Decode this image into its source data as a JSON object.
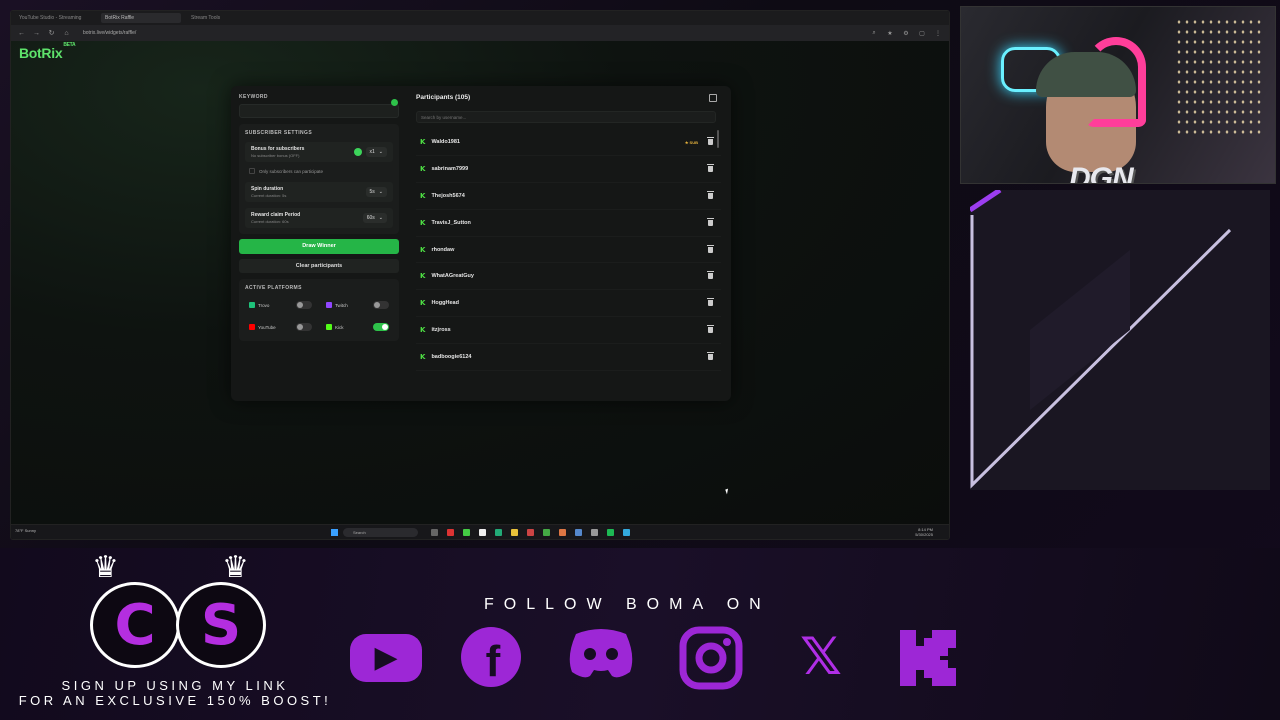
{
  "browser": {
    "tabs": [
      "YouTube Studio - Streaming",
      "BotRix Raffle",
      "Stream Tools"
    ],
    "url": "botrix.live/widgets/raffle/"
  },
  "app": {
    "logo": "BotRix",
    "logo_badge": "BETA"
  },
  "settings": {
    "keyword_label": "KEYWORD",
    "keyword_value": "",
    "subscriber_section": "SUBSCRIBER SETTINGS",
    "bonus_title": "Bonus for subscribers",
    "bonus_sub": "No subscriber bonus (OFF)",
    "bonus_value": "x1",
    "only_subs_label": "Only subscribers can participate",
    "spin_title": "Spin duration",
    "spin_sub": "Current duration: 5s",
    "spin_value": "5s",
    "reward_title": "Reward claim Period",
    "reward_sub": "Current duration: 60s",
    "reward_value": "60s",
    "draw_button": "Draw Winner",
    "clear_button": "Clear participants",
    "platforms_section": "ACTIVE PLATFORMS",
    "platforms": [
      {
        "name": "Trovo",
        "on": false,
        "color": "#1ec27a"
      },
      {
        "name": "Twitch",
        "on": false,
        "color": "#9146ff"
      },
      {
        "name": "YouTube",
        "on": false,
        "color": "#ff0000"
      },
      {
        "name": "Kick",
        "on": true,
        "color": "#53fc18"
      }
    ]
  },
  "participants": {
    "title": "Participants (105)",
    "search_placeholder": "Search by username...",
    "sub_badge": "★ SUB",
    "list": [
      {
        "name": "Waldo1981",
        "sub": true
      },
      {
        "name": "sabrinam7999",
        "sub": false
      },
      {
        "name": "Thejosh5674",
        "sub": false
      },
      {
        "name": "TravisJ_Sutton",
        "sub": false
      },
      {
        "name": "rhondaw",
        "sub": false
      },
      {
        "name": "WhatAGreatGuy",
        "sub": false
      },
      {
        "name": "HoggHead",
        "sub": false
      },
      {
        "name": "itzjross",
        "sub": false
      },
      {
        "name": "badboogie6124",
        "sub": false
      }
    ]
  },
  "taskbar": {
    "weather_temp": "78°F",
    "weather_desc": "Sunny",
    "search_label": "Search",
    "time": "8:14 PM",
    "date": "5/30/2025"
  },
  "overlay": {
    "coin_left": "C",
    "coin_right": "S",
    "signup_line1": "SIGN UP USING MY LINK",
    "signup_line2": "FOR AN EXCLUSIVE 150% BOOST!",
    "follow_text": "FOLLOW BOMA ON",
    "webcam_logo": "DGN",
    "socials": [
      "youtube-icon",
      "facebook-icon",
      "discord-icon",
      "instagram-icon",
      "x-icon",
      "kick-icon"
    ]
  }
}
